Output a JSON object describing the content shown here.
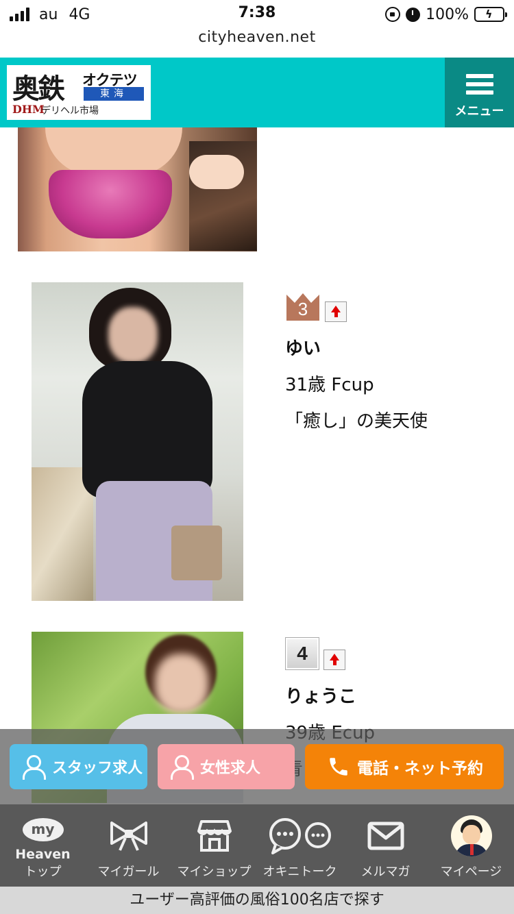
{
  "status_bar": {
    "carrier": "au",
    "network": "4G",
    "time": "7:38",
    "battery": "100%",
    "url": "cityheaven.net"
  },
  "header": {
    "logo_kanji": "奥鉄",
    "logo_kana": "オクテツ",
    "logo_region": "東海",
    "logo_sub": "デリヘル市場",
    "logo_mark": "DHM",
    "menu_label": "メニュー",
    "brand_color": "#00c8c8",
    "menu_color": "#0a8a85"
  },
  "girls": [
    {
      "rank": "3",
      "rank_style": "bronze-crown",
      "trend": "up",
      "name": "ゆい",
      "spec": "31歳 Fcup",
      "catchphrase": "「癒し」の美天使"
    },
    {
      "rank": "4",
      "rank_style": "plain",
      "trend": "up",
      "name": "りょうこ",
      "spec": "39歳 Ecup",
      "catchphrase": "青"
    }
  ],
  "actions": {
    "staff": "スタッフ求人",
    "women": "女性求人",
    "tel": "電話・ネット予約",
    "staff_color": "#56bfe8",
    "women_color": "#f7a3a8",
    "tel_color": "#f48308"
  },
  "tabs": [
    {
      "icon": "my-heaven-icon",
      "badge": "my",
      "sub": "Heaven",
      "label": "トップ"
    },
    {
      "icon": "ribbon-icon",
      "label": "マイガール"
    },
    {
      "icon": "shop-icon",
      "label": "マイショップ"
    },
    {
      "icon": "chat-bubbles-icon",
      "label": "オキニトーク"
    },
    {
      "icon": "mail-icon",
      "label": "メルマガ"
    },
    {
      "icon": "avatar-icon",
      "label": "マイページ"
    }
  ],
  "banner": "ユーザー高評価の風俗100名店で探す"
}
